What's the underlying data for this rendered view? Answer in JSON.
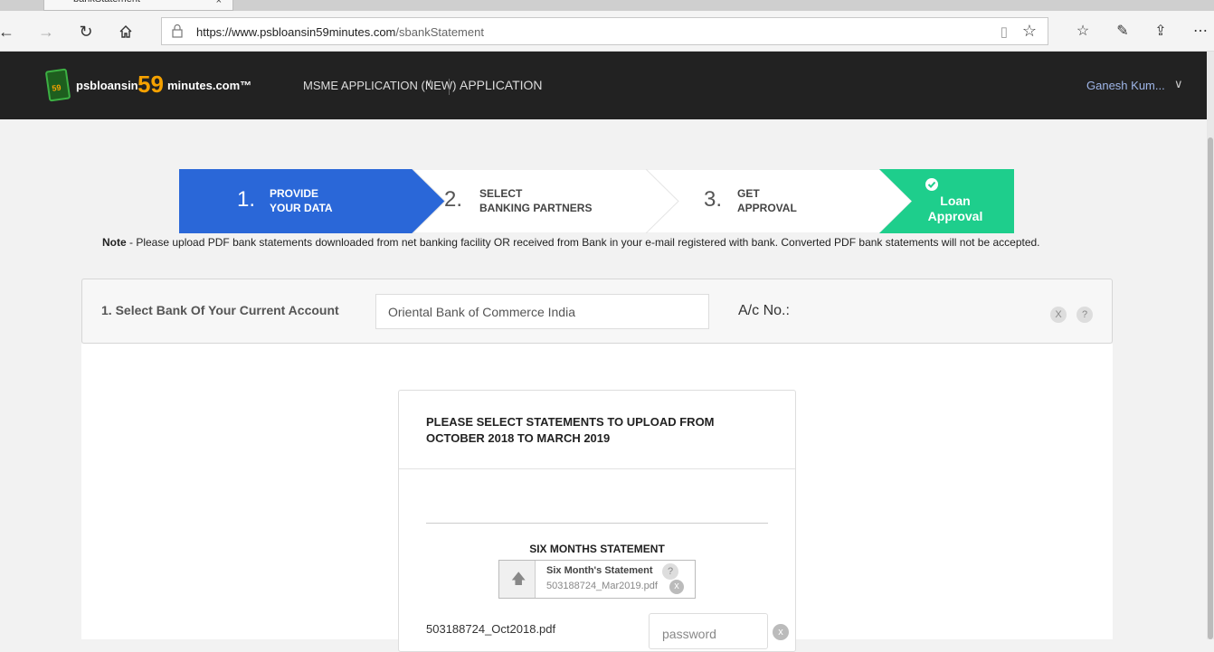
{
  "browser": {
    "tab_title": "bankStatement",
    "tab_close": "×",
    "url_host": "https://www.psbloansin59minutes.com",
    "url_path": "/sbankStatement"
  },
  "header": {
    "logo_badge": "59",
    "logo_text1": "psbloansin",
    "logo_59": "59",
    "logo_text2": "minutes.com™",
    "nav": [
      "MSME APPLICATION (NEW)",
      "APPLICATION"
    ],
    "user": "Ganesh Kum..."
  },
  "stepper": {
    "steps": [
      {
        "num": "1.",
        "line1": "PROVIDE",
        "line2": "YOUR DATA"
      },
      {
        "num": "2.",
        "line1": "SELECT",
        "line2": "BANKING PARTNERS"
      },
      {
        "num": "3.",
        "line1": "GET",
        "line2": "APPROVAL"
      },
      {
        "line1": "Loan",
        "line2": "Approval"
      }
    ],
    "colors": {
      "active": "#2a67d8",
      "done": "#1ece8c",
      "inactive": "#ffffff"
    }
  },
  "note": {
    "label": "Note",
    "text": " - Please upload PDF bank statements downloaded from net banking facility OR received from Bank in your e-mail registered with bank. Converted PDF bank statements will not be accepted."
  },
  "bank": {
    "label": "1. Select Bank Of Your Current Account",
    "selected": "Oriental Bank of Commerce India",
    "acno_label": "A/c No.:",
    "clear": "X",
    "help": "?"
  },
  "upload": {
    "title": "PLEASE SELECT STATEMENTS TO UPLOAD FROM OCTOBER 2018 TO MARCH 2019",
    "section_title": "SIX MONTHS STATEMENT",
    "file_title": "Six Month's Statement",
    "file_name": "503188724_Mar2019.pdf",
    "help": "?",
    "remove": "x",
    "row_file": "503188724_Oct2018.pdf",
    "password_placeholder": "password",
    "row_remove": "x"
  }
}
